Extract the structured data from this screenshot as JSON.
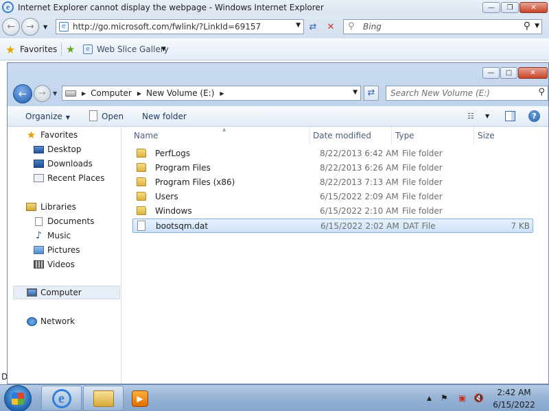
{
  "ie": {
    "title": "Internet Explorer cannot display the webpage - Windows Internet Explorer",
    "address": "http://go.microsoft.com/fwlink/?LinkId=69157",
    "search_placeholder": "Bing",
    "favorites_label": "Favorites",
    "web_slice_label": "Web Slice Gallery",
    "edge_letter": "D"
  },
  "explorer": {
    "breadcrumb": [
      "Computer",
      "New Volume (E:)"
    ],
    "search_placeholder": "Search New Volume (E:)",
    "commands": {
      "organize": "Organize",
      "open": "Open",
      "new_folder": "New folder"
    },
    "nav": {
      "favorites": "Favorites",
      "desktop": "Desktop",
      "downloads": "Downloads",
      "recent_places": "Recent Places",
      "libraries": "Libraries",
      "documents": "Documents",
      "music": "Music",
      "pictures": "Pictures",
      "videos": "Videos",
      "computer": "Computer",
      "network": "Network"
    },
    "columns": {
      "name": "Name",
      "date_modified": "Date modified",
      "type": "Type",
      "size": "Size"
    },
    "files": [
      {
        "name": "PerfLogs",
        "date": "8/22/2013 6:42 AM",
        "type": "File folder",
        "size": "",
        "kind": "folder"
      },
      {
        "name": "Program Files",
        "date": "8/22/2013 6:26 AM",
        "type": "File folder",
        "size": "",
        "kind": "folder"
      },
      {
        "name": "Program Files (x86)",
        "date": "8/22/2013 7:13 AM",
        "type": "File folder",
        "size": "",
        "kind": "folder"
      },
      {
        "name": "Users",
        "date": "6/15/2022 2:09 AM",
        "type": "File folder",
        "size": "",
        "kind": "folder"
      },
      {
        "name": "Windows",
        "date": "6/15/2022 2:10 AM",
        "type": "File folder",
        "size": "",
        "kind": "folder"
      },
      {
        "name": "bootsqm.dat",
        "date": "6/15/2022 2:02 AM",
        "type": "DAT File",
        "size": "7 KB",
        "kind": "file"
      }
    ]
  },
  "taskbar": {
    "time": "2:42 AM",
    "date": "6/15/2022"
  },
  "icons": {
    "ie": "internet-explorer-icon",
    "explorer": "windows-explorer-icon",
    "media": "media-player-icon"
  }
}
